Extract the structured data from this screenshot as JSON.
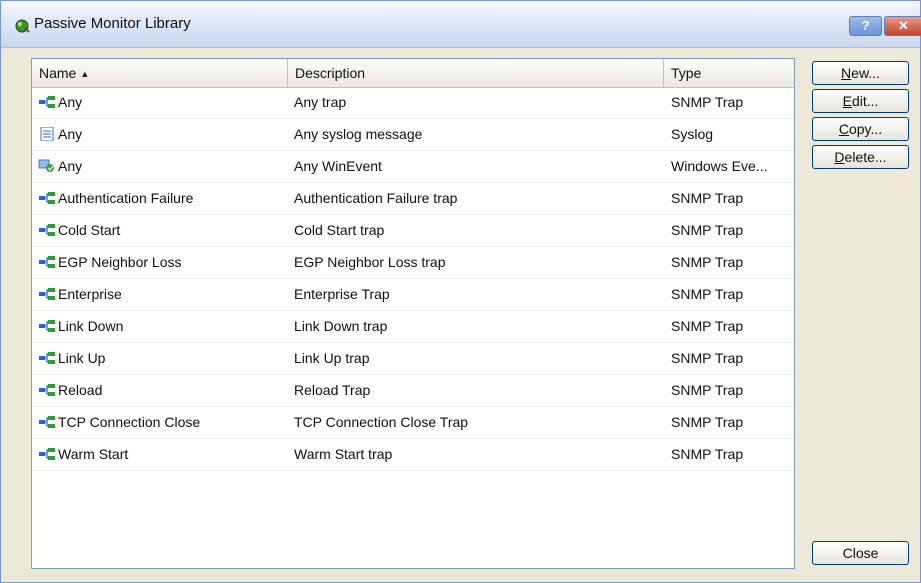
{
  "window": {
    "title": "Passive Monitor Library",
    "help_label": "?",
    "close_label": "✕"
  },
  "columns": {
    "name": "Name",
    "description": "Description",
    "type": "Type",
    "sort_indicator": "▲"
  },
  "rows": [
    {
      "icon": "snmp-trap-icon",
      "name": "Any",
      "description": "Any trap",
      "type": "SNMP Trap"
    },
    {
      "icon": "syslog-icon",
      "name": "Any",
      "description": "Any syslog message",
      "type": "Syslog"
    },
    {
      "icon": "winevent-icon",
      "name": "Any",
      "description": "Any WinEvent",
      "type": "Windows Eve..."
    },
    {
      "icon": "snmp-trap-icon",
      "name": "Authentication Failure",
      "description": "Authentication Failure trap",
      "type": "SNMP Trap"
    },
    {
      "icon": "snmp-trap-icon",
      "name": "Cold Start",
      "description": "Cold Start trap",
      "type": "SNMP Trap"
    },
    {
      "icon": "snmp-trap-icon",
      "name": "EGP Neighbor Loss",
      "description": "EGP Neighbor Loss trap",
      "type": "SNMP Trap"
    },
    {
      "icon": "snmp-trap-icon",
      "name": "Enterprise",
      "description": "Enterprise Trap",
      "type": "SNMP Trap"
    },
    {
      "icon": "snmp-trap-icon",
      "name": "Link Down",
      "description": "Link Down trap",
      "type": "SNMP Trap"
    },
    {
      "icon": "snmp-trap-icon",
      "name": "Link Up",
      "description": "Link Up trap",
      "type": "SNMP Trap"
    },
    {
      "icon": "snmp-trap-icon",
      "name": "Reload",
      "description": "Reload Trap",
      "type": "SNMP Trap"
    },
    {
      "icon": "snmp-trap-icon",
      "name": "TCP Connection Close",
      "description": "TCP Connection Close Trap",
      "type": "SNMP Trap"
    },
    {
      "icon": "snmp-trap-icon",
      "name": "Warm Start",
      "description": "Warm Start trap",
      "type": "SNMP Trap"
    }
  ],
  "buttons": {
    "new": {
      "accel": "N",
      "rest": "ew..."
    },
    "edit": {
      "accel": "E",
      "rest": "dit..."
    },
    "copy": {
      "accel": "C",
      "rest": "opy..."
    },
    "delete": {
      "accel": "D",
      "rest": "elete..."
    },
    "close": "Close"
  },
  "colors": {
    "window_bg": "#ece9d8",
    "title_bg": "#dbe5f5",
    "border": "#7f9db9",
    "snmp_green": "#2f9a3a",
    "snmp_blue": "#2a63b8"
  }
}
